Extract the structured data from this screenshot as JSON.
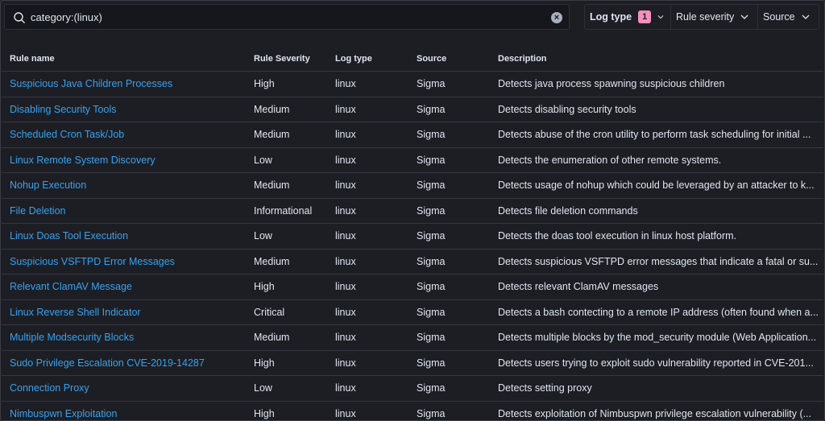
{
  "search": {
    "value": "category:(linux)"
  },
  "filters": {
    "log_type": {
      "label": "Log type",
      "count": "1"
    },
    "rule_severity": {
      "label": "Rule severity"
    },
    "source": {
      "label": "Source"
    }
  },
  "table": {
    "headers": {
      "rule_name": "Rule name",
      "severity": "Rule Severity",
      "log_type": "Log type",
      "source": "Source",
      "description": "Description"
    },
    "rows": [
      {
        "name": "Suspicious Java Children Processes",
        "severity": "High",
        "log_type": "linux",
        "source": "Sigma",
        "description": "Detects java process spawning suspicious children"
      },
      {
        "name": "Disabling Security Tools",
        "severity": "Medium",
        "log_type": "linux",
        "source": "Sigma",
        "description": "Detects disabling security tools"
      },
      {
        "name": "Scheduled Cron Task/Job",
        "severity": "Medium",
        "log_type": "linux",
        "source": "Sigma",
        "description": "Detects abuse of the cron utility to perform task scheduling for initial ..."
      },
      {
        "name": "Linux Remote System Discovery",
        "severity": "Low",
        "log_type": "linux",
        "source": "Sigma",
        "description": "Detects the enumeration of other remote systems."
      },
      {
        "name": "Nohup Execution",
        "severity": "Medium",
        "log_type": "linux",
        "source": "Sigma",
        "description": "Detects usage of nohup which could be leveraged by an attacker to k..."
      },
      {
        "name": "File Deletion",
        "severity": "Informational",
        "log_type": "linux",
        "source": "Sigma",
        "description": "Detects file deletion commands"
      },
      {
        "name": "Linux Doas Tool Execution",
        "severity": "Low",
        "log_type": "linux",
        "source": "Sigma",
        "description": "Detects the doas tool execution in linux host platform."
      },
      {
        "name": "Suspicious VSFTPD Error Messages",
        "severity": "Medium",
        "log_type": "linux",
        "source": "Sigma",
        "description": "Detects suspicious VSFTPD error messages that indicate a fatal or su..."
      },
      {
        "name": "Relevant ClamAV Message",
        "severity": "High",
        "log_type": "linux",
        "source": "Sigma",
        "description": "Detects relevant ClamAV messages"
      },
      {
        "name": "Linux Reverse Shell Indicator",
        "severity": "Critical",
        "log_type": "linux",
        "source": "Sigma",
        "description": "Detects a bash contecting to a remote IP address (often found when a..."
      },
      {
        "name": "Multiple Modsecurity Blocks",
        "severity": "Medium",
        "log_type": "linux",
        "source": "Sigma",
        "description": "Detects multiple blocks by the mod_security module (Web Application..."
      },
      {
        "name": "Sudo Privilege Escalation CVE-2019-14287",
        "severity": "High",
        "log_type": "linux",
        "source": "Sigma",
        "description": "Detects users trying to exploit sudo vulnerability reported in CVE-201..."
      },
      {
        "name": "Connection Proxy",
        "severity": "Low",
        "log_type": "linux",
        "source": "Sigma",
        "description": "Detects setting proxy"
      },
      {
        "name": "Nimbuspwn Exploitation",
        "severity": "High",
        "log_type": "linux",
        "source": "Sigma",
        "description": "Detects exploitation of Nimbuspwn privilege escalation vulnerability (..."
      }
    ]
  },
  "colors": {
    "background": "#1d1e24",
    "link": "#36a2ef",
    "badge": "#f68fbe"
  }
}
